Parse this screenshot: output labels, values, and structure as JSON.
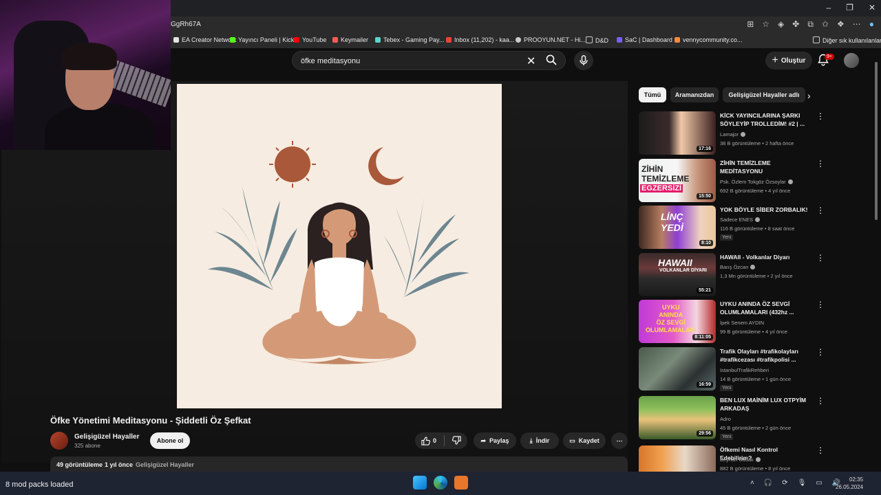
{
  "browser": {
    "address": "GgRh67A",
    "bookmarks": [
      {
        "label": "EA Creator Network",
        "color": "#e2e2e2"
      },
      {
        "label": "Yayıncı Paneli | Kick",
        "color": "#53fc18"
      },
      {
        "label": "YouTube",
        "color": "#ff0000"
      },
      {
        "label": "Keymailer",
        "color": "#ff5a5a"
      },
      {
        "label": "Tebex - Gaming Pay...",
        "color": "#5ad6c8"
      },
      {
        "label": "Inbox (11,202) - kaa...",
        "color": "#ea4335"
      },
      {
        "label": "PROOYUN.NET - Hi...",
        "color": "#cccccc"
      },
      {
        "label": "D&D",
        "color": "#cccccc"
      },
      {
        "label": "SaC | Dashboard",
        "color": "#7c5cff"
      },
      {
        "label": "vennycommunity.co...",
        "color": "#ff8a3d"
      }
    ],
    "other_bookmarks": "Diğer sık kullanılanlar"
  },
  "youtube": {
    "search": {
      "value": "öfke meditasyonu"
    },
    "create_label": "Oluştur",
    "notif_count": "9+",
    "video": {
      "title": "Öfke Yönetimi Meditasyonu - Şiddetli Öz Şefkat",
      "channel": "Gelişigüzel Hayaller",
      "subs": "325 abone",
      "subscribe_label": "Abone ol",
      "likes": "0",
      "share_label": "Paylaş",
      "download_label": "İndir",
      "save_label": "Kaydet",
      "views": "49 görüntüleme",
      "age": "1 yıl önce",
      "desc_channel": "Gelişigüzel Hayaller"
    },
    "chips": [
      "Tümü",
      "Aramanızdan",
      "Gelişigüzel Hayaller adlı"
    ],
    "recommendations": [
      {
        "title": "KİCK YAYINCILARINA ŞARKI SÖYLEYİP TROLLEDİM! #2 | ...",
        "channel": "Lamajor",
        "meta": "38 B görüntüleme • 2 hafta önce",
        "duration": "17:16",
        "new": ""
      },
      {
        "title": "ZİHİN TEMİZLEME MEDİTASYONU",
        "channel": "Psk. Özlem Tokgöz Özsoylar",
        "meta": "692 B görüntüleme • 4 yıl önce",
        "duration": "15:50",
        "new": ""
      },
      {
        "title": "YOK BÖYLE SİBER ZORBALIK!",
        "channel": "Sadece ENES",
        "meta": "116 B görüntüleme • 8 saat önce",
        "duration": "8:10",
        "new": "Yeni"
      },
      {
        "title": "HAWAII - Volkanlar Diyarı",
        "channel": "Barış Özcan",
        "meta": "1,3 Mn görüntüleme • 2 yıl önce",
        "duration": "55:21",
        "new": ""
      },
      {
        "title": "UYKU ANINDA ÖZ SEVGİ OLUMLAMALARI (432hz ...",
        "channel": "İpek Senem AYDIN",
        "meta": "99 B görüntüleme • 4 yıl önce",
        "duration": "8:11:05",
        "new": ""
      },
      {
        "title": "Trafik Olayları #trafikolayları #trafikcezası #trafikpolisi ...",
        "channel": "IstanbulTrafikRehberi",
        "meta": "14 B görüntüleme • 1 gün önce",
        "duration": "16:59",
        "new": "Yeni"
      },
      {
        "title": "BEN LUX MAİNİM LUX OTPYİM ARKADAŞ",
        "channel": "Adro",
        "meta": "45 B görüntüleme • 2 gün önce",
        "duration": "29:56",
        "new": "Yeni"
      },
      {
        "title": "Öfkemi Nasıl Kontrol Edebilirim?",
        "channel": "Beyhan Budak",
        "meta": "882 B görüntüleme • 8 yıl önce",
        "duration": "",
        "new": ""
      }
    ]
  },
  "taskbar": {
    "status": "8 mod packs loaded",
    "time": "02:35",
    "date": "26.05.2024"
  },
  "colors": {
    "accent": "#cc0000",
    "bg": "#0f0f0f",
    "chip": "#272727"
  }
}
